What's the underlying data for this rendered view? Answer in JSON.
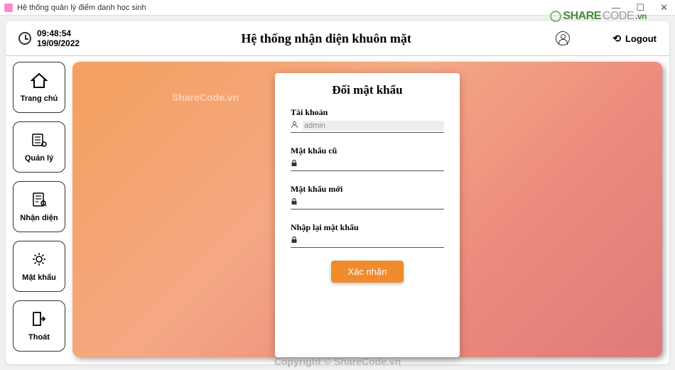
{
  "titlebar": {
    "title": "Hệ thống quản lý điểm danh học sinh"
  },
  "watermarks": {
    "corner_share": "SHARE",
    "corner_code": "CODE",
    "corner_vn": ".vn",
    "center": "ShareCode.vn",
    "bottom": "Copyright © ShareCode.vn"
  },
  "header": {
    "time": "09:48:54",
    "date": "19/09/2022",
    "title": "Hệ thống nhận diện khuôn mặt",
    "logout_label": "Logout"
  },
  "sidebar": {
    "items": [
      {
        "icon": "home",
        "label": "Trang chủ"
      },
      {
        "icon": "manage",
        "label": "Quản lý"
      },
      {
        "icon": "detect",
        "label": "Nhận diện"
      },
      {
        "icon": "password",
        "label": "Mật khẩu"
      },
      {
        "icon": "exit",
        "label": "Thoát"
      }
    ]
  },
  "form": {
    "title": "Đổi mật khẩu",
    "account_label": "Tài khoản",
    "account_value": "admin",
    "oldpw_label": "Mật khẩu cũ",
    "newpw_label": "Mật khẩu mới",
    "confirmpw_label": "Nhập lại mật khẩu",
    "submit_label": "Xác nhận"
  }
}
